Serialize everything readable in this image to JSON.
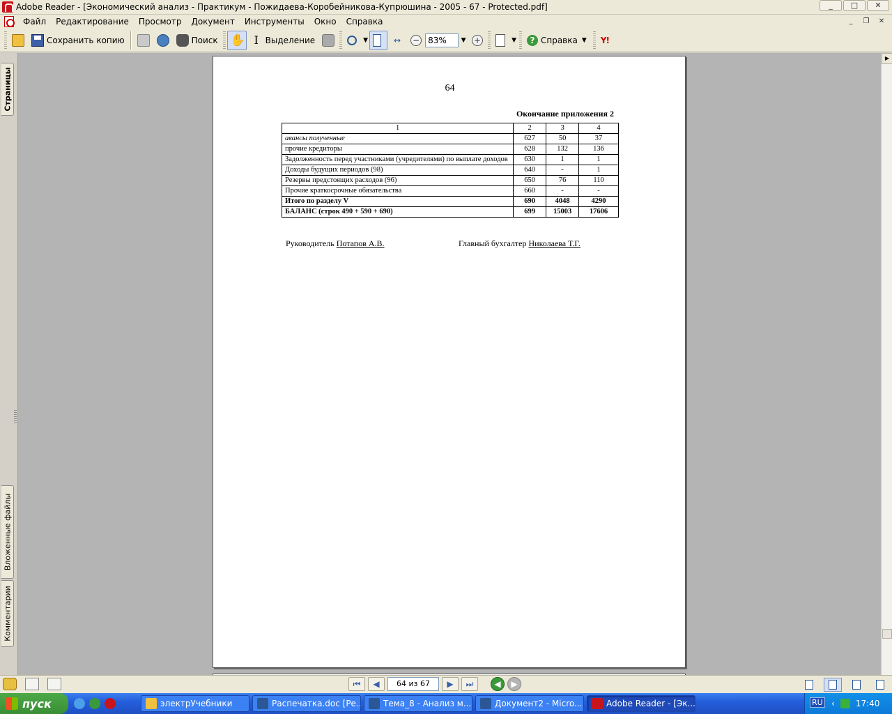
{
  "window": {
    "title": "Adobe Reader - [Экономический анализ - Практикум - Пожидаева-Коробейникова-Купрюшина - 2005 - 67 - Protected.pdf]",
    "controls": [
      "_",
      "□",
      "✕"
    ]
  },
  "menu": {
    "items": [
      "Файл",
      "Редактирование",
      "Просмотр",
      "Документ",
      "Инструменты",
      "Окно",
      "Справка"
    ]
  },
  "toolbar": {
    "save_copy_label": "Сохранить копию",
    "search_label": "Поиск",
    "select_label": "Выделение",
    "zoom_value": "83%",
    "help_label": "Справка",
    "yahoo_label": "Y!"
  },
  "side_tabs": {
    "pages": "Страницы",
    "attachments": "Вложенные файлы",
    "comments": "Комментарии"
  },
  "document": {
    "page_number": "64",
    "heading": "Окончание приложения 2",
    "table": {
      "header": [
        "1",
        "2",
        "3",
        "4"
      ],
      "rows": [
        {
          "name": "авансы полученные",
          "code": "627",
          "start": "50",
          "end": "37",
          "italic": true
        },
        {
          "name": "прочие кредиторы",
          "code": "628",
          "start": "132",
          "end": "136"
        },
        {
          "name": "Задолженность перед участниками (учредителями) по выплате доходов",
          "code": "630",
          "start": "1",
          "end": "1"
        },
        {
          "name": "Доходы будущих периодов (98)",
          "code": "640",
          "start": "-",
          "end": "1"
        },
        {
          "name": "Резервы предстоящих расходов (96)",
          "code": "650",
          "start": "76",
          "end": "110"
        },
        {
          "name": "Прочие краткосрочные обязательства",
          "code": "660",
          "start": "-",
          "end": "-"
        },
        {
          "name": "Итого по разделу V",
          "code": "690",
          "start": "4048",
          "end": "4290",
          "bold": true
        },
        {
          "name": "БАЛАНС (строк 490 + 590 + 690)",
          "code": "699",
          "start": "15003",
          "end": "17606",
          "bold": true
        }
      ]
    },
    "signatures": {
      "director_label": "Руководитель",
      "director_name": "Потапов А.В.",
      "accountant_label": "Главный бухгалтер",
      "accountant_name": "Николаева Т.Г."
    }
  },
  "status": {
    "page_indicator": "64 из 67"
  },
  "taskbar": {
    "start_label": "пуск",
    "tasks": [
      {
        "label": "электрУчебники",
        "color": "#f0c040"
      },
      {
        "label": "Распечатка.doc [Ре...",
        "color": "#2b5797"
      },
      {
        "label": "Тема_8 - Анализ м...",
        "color": "#2b5797"
      },
      {
        "label": "Документ2 - Micro...",
        "color": "#2b5797"
      },
      {
        "label": "Adobe Reader - [Эк...",
        "color": "#c8141b"
      }
    ],
    "language": "RU",
    "clock": "17:40"
  },
  "colors": {
    "taskbar": "#245edb",
    "start": "#3a8e36",
    "viewport": "#b4b4b4",
    "window_chrome": "#ece9d8"
  }
}
